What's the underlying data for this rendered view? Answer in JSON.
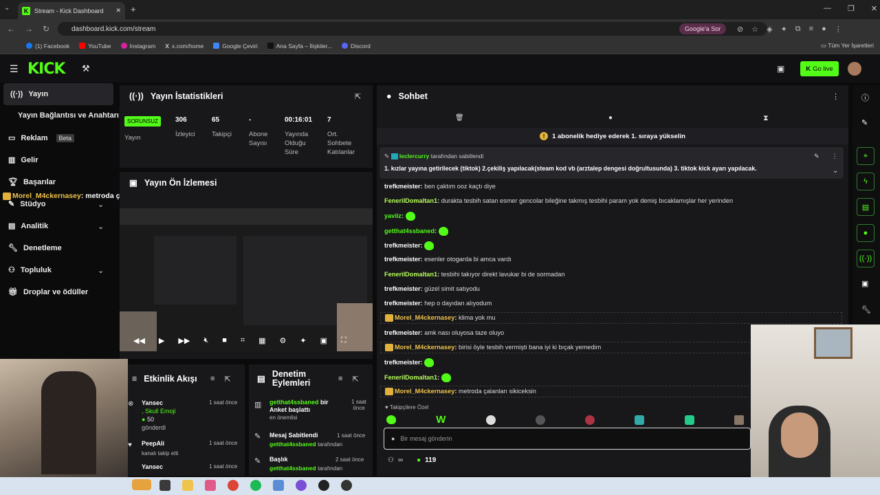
{
  "browser": {
    "tab_title": "Stream - Kick Dashboard",
    "url": "dashboard.kick.com/stream",
    "google_btn": "Google'a Sor",
    "bookmarks": [
      "(1) Facebook",
      "YouTube",
      "Instagram",
      "x.com/home",
      "Google Çeviri",
      "Ana Sayfa – İlişkiler...",
      "Discord"
    ],
    "all_bookmarks": "Tüm Yer İşaretleri"
  },
  "header": {
    "logo": "KICK",
    "go_live": "Go live"
  },
  "sidebar": {
    "items": [
      {
        "label": "Yayın"
      },
      {
        "label": "Yayın Bağlantısı ve Anahtarı"
      },
      {
        "label": "Reklam",
        "badge": "Beta"
      },
      {
        "label": "Gelir"
      },
      {
        "label": "Başarılar"
      },
      {
        "label": "Stüdyo"
      },
      {
        "label": "Analitik"
      },
      {
        "label": "Denetleme"
      },
      {
        "label": "Topluluk"
      },
      {
        "label": "Droplar ve ödüller"
      }
    ],
    "overlay_user": "Morel_M4ckernasey",
    "overlay_text": ": metroda çalanları sikiceksin"
  },
  "stats": {
    "title": "Yayın İstatistikleri",
    "status_badge": "SORUNSUZ",
    "status_label": "Yayın",
    "viewers": {
      "value": "306",
      "label": "İzleyici"
    },
    "followers": {
      "value": "65",
      "label": "Takipçi"
    },
    "subs": {
      "value": "-",
      "label": "Abone Sayısı"
    },
    "uptime": {
      "value": "00:16:01",
      "label": "Yayında Olduğu Süre"
    },
    "chatters": {
      "value": "7",
      "label": "Ort. Sohbete Katılanlar"
    }
  },
  "preview": {
    "title": "Yayın Ön İzlemesi"
  },
  "activity": {
    "title": "Etkinlik Akışı",
    "items": [
      {
        "user": "Yansec",
        "time": "1 saat önce",
        "detail": ", Skull Emoji",
        "amount": "50",
        "action": "gönderdi"
      },
      {
        "user": "PeepAli",
        "time": "1 saat önce",
        "action": "kanalı takip etti"
      },
      {
        "user": "Yansec",
        "time": "1 saat önce"
      }
    ]
  },
  "modactions": {
    "title": "Denetim Eylemleri",
    "items": [
      {
        "user": "getthat4ssbaned",
        "text": "bir Anket başlattı",
        "sub": "en önemlisi",
        "time": "1 saat önce"
      },
      {
        "title": "Mesaj Sabitlendi",
        "user": "getthat4ssbaned",
        "by": "tarafından",
        "time": "1 saat önce"
      },
      {
        "title": "Başlık",
        "user": "getthat4ssbaned",
        "by": "tarafından",
        "time": "2 saat önce"
      }
    ]
  },
  "chat": {
    "title": "Sohbet",
    "sub_banner": "1 abonelik hediye ederek 1. sıraya yükselin",
    "pinned_by_user": "leclercurry",
    "pinned_by_text": "tarafından sabitlendi",
    "pinned_text": "1. kızlar yayına getirilecek (tiktok) 2.çekiliş yapılacak(steam kod vb (arztalep dengesi doğrultusunda) 3. tiktok kick ayarı yapılacak.",
    "messages": [
      {
        "user": "trefkmeister",
        "text": "ben çaktım ooz kaçtı diye",
        "color": "#ffffff"
      },
      {
        "user": "FeneriIDomaltan1",
        "text": "durakta tesbih satan esmer gencolar bileğine takmış tesbihi param yok demiş bıcaklamışlar her yerinden",
        "color": "#b6ff5a"
      },
      {
        "user": "yaviiz",
        "text": "",
        "emote": true,
        "color": "#53fc18"
      },
      {
        "user": "getthat4ssbaned",
        "text": "",
        "emote": true,
        "color": "#53fc18"
      },
      {
        "user": "trefkmeister",
        "text": "",
        "emote": true,
        "color": "#ffffff"
      },
      {
        "user": "trefkmeister",
        "text": "esenler otogarda bi amca vardı",
        "color": "#ffffff"
      },
      {
        "user": "FeneriIDomaltan1",
        "text": "tesbihi takıyor direkt lavukar bi de sormadan",
        "color": "#b6ff5a"
      },
      {
        "user": "trefkmeister",
        "text": "güzel simit satıyodu",
        "color": "#ffffff"
      },
      {
        "user": "trefkmeister",
        "text": "hep o dayıdan alıyodum",
        "color": "#ffffff"
      },
      {
        "user": "Morel_M4ckernasey",
        "text": "klima yok mu",
        "color": "#f0c34c"
      },
      {
        "user": "trefkmeister",
        "text": "amk nası oluyosa taze oluyo",
        "color": "#ffffff"
      },
      {
        "user": "Morel_M4ckernasey",
        "text": "birisi öyle tesbih vermişti bana iyi ki bıçak yemedim",
        "color": "#f0c34c"
      },
      {
        "user": "trefkmeister",
        "text": "",
        "emote": true,
        "color": "#ffffff"
      },
      {
        "user": "FeneriIDomaltan1",
        "text": "",
        "emote": true,
        "color": "#b6ff5a"
      },
      {
        "user": "Morel_M4ckernasey",
        "text": "metroda çalanları sikiceksin",
        "color": "#f0c34c"
      }
    ],
    "followers_only": "Takipçilere Özel",
    "input_placeholder": "Bir mesaj gönderin",
    "infinity": "∞",
    "points": "119"
  },
  "colors": {
    "accent": "#53fc18",
    "panel": "#18181b",
    "bg": "#0b0b0c"
  }
}
